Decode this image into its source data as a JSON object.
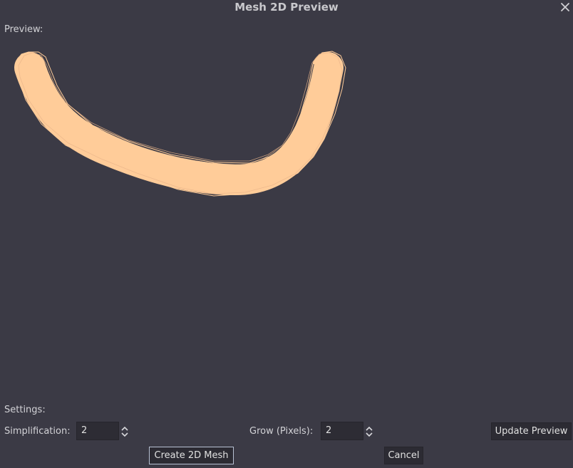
{
  "window": {
    "title": "Mesh 2D Preview",
    "close_icon": "close-icon"
  },
  "preview": {
    "label": "Preview:",
    "shape_fill": "#ffcc99",
    "outline_color": "#ffcc99"
  },
  "settings": {
    "label": "Settings:",
    "simplification": {
      "label": "Simplification:",
      "value": "2"
    },
    "grow": {
      "label": "Grow (Pixels):",
      "value": "2"
    },
    "update_button": "Update Preview"
  },
  "footer": {
    "create_button": "Create 2D Mesh",
    "cancel_button": "Cancel"
  },
  "colors": {
    "background": "#3b3a45",
    "field_background": "#2d2c34",
    "focus_border": "#b8c2d4"
  }
}
